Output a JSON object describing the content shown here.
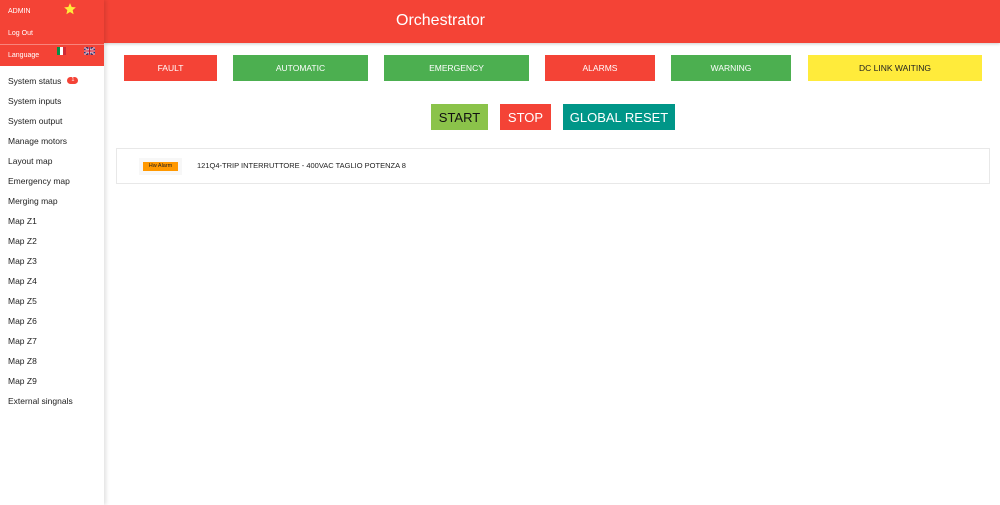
{
  "sidebar": {
    "user": "ADMIN",
    "logout": "Log Out",
    "language": "Language",
    "items": [
      {
        "label": "System status",
        "badge": "1"
      },
      {
        "label": "System inputs"
      },
      {
        "label": "System output"
      },
      {
        "label": "Manage motors"
      },
      {
        "label": "Layout map"
      },
      {
        "label": "Emergency map"
      },
      {
        "label": "Merging map"
      },
      {
        "label": "Map Z1"
      },
      {
        "label": "Map Z2"
      },
      {
        "label": "Map Z3"
      },
      {
        "label": "Map Z4"
      },
      {
        "label": "Map Z5"
      },
      {
        "label": "Map Z6"
      },
      {
        "label": "Map Z7"
      },
      {
        "label": "Map Z8"
      },
      {
        "label": "Map Z9"
      },
      {
        "label": "External singnals"
      }
    ]
  },
  "header": {
    "title": "Orchestrator"
  },
  "status": {
    "fault": "FAULT",
    "automatic": "AUTOMATIC",
    "emergency": "EMERGENCY",
    "alarms": "ALARMS",
    "warning": "WARNING",
    "dc_link": "DC LINK WAITING"
  },
  "controls": {
    "start": "START",
    "stop": "STOP",
    "reset": "GLOBAL RESET"
  },
  "alarms": [
    {
      "tag": "Hw Alarm",
      "message": "121Q4-TRIP INTERRUTTORE - 400VAC TAGLIO POTENZA 8"
    }
  ],
  "colors": {
    "primary_red": "#f44336",
    "green": "#4caf50",
    "yellow": "#ffeb3b",
    "teal": "#009688",
    "light_green": "#8bc34a",
    "orange": "#ff9800"
  }
}
